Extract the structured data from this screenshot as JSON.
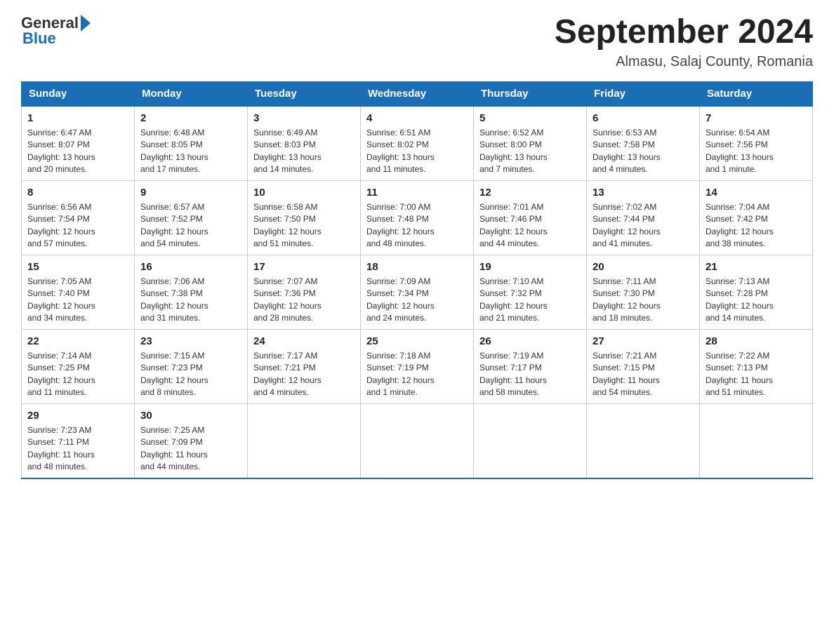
{
  "header": {
    "logo_general": "General",
    "logo_blue": "Blue",
    "month_title": "September 2024",
    "location": "Almasu, Salaj County, Romania"
  },
  "weekdays": [
    "Sunday",
    "Monday",
    "Tuesday",
    "Wednesday",
    "Thursday",
    "Friday",
    "Saturday"
  ],
  "weeks": [
    [
      {
        "day": "1",
        "info": "Sunrise: 6:47 AM\nSunset: 8:07 PM\nDaylight: 13 hours\nand 20 minutes."
      },
      {
        "day": "2",
        "info": "Sunrise: 6:48 AM\nSunset: 8:05 PM\nDaylight: 13 hours\nand 17 minutes."
      },
      {
        "day": "3",
        "info": "Sunrise: 6:49 AM\nSunset: 8:03 PM\nDaylight: 13 hours\nand 14 minutes."
      },
      {
        "day": "4",
        "info": "Sunrise: 6:51 AM\nSunset: 8:02 PM\nDaylight: 13 hours\nand 11 minutes."
      },
      {
        "day": "5",
        "info": "Sunrise: 6:52 AM\nSunset: 8:00 PM\nDaylight: 13 hours\nand 7 minutes."
      },
      {
        "day": "6",
        "info": "Sunrise: 6:53 AM\nSunset: 7:58 PM\nDaylight: 13 hours\nand 4 minutes."
      },
      {
        "day": "7",
        "info": "Sunrise: 6:54 AM\nSunset: 7:56 PM\nDaylight: 13 hours\nand 1 minute."
      }
    ],
    [
      {
        "day": "8",
        "info": "Sunrise: 6:56 AM\nSunset: 7:54 PM\nDaylight: 12 hours\nand 57 minutes."
      },
      {
        "day": "9",
        "info": "Sunrise: 6:57 AM\nSunset: 7:52 PM\nDaylight: 12 hours\nand 54 minutes."
      },
      {
        "day": "10",
        "info": "Sunrise: 6:58 AM\nSunset: 7:50 PM\nDaylight: 12 hours\nand 51 minutes."
      },
      {
        "day": "11",
        "info": "Sunrise: 7:00 AM\nSunset: 7:48 PM\nDaylight: 12 hours\nand 48 minutes."
      },
      {
        "day": "12",
        "info": "Sunrise: 7:01 AM\nSunset: 7:46 PM\nDaylight: 12 hours\nand 44 minutes."
      },
      {
        "day": "13",
        "info": "Sunrise: 7:02 AM\nSunset: 7:44 PM\nDaylight: 12 hours\nand 41 minutes."
      },
      {
        "day": "14",
        "info": "Sunrise: 7:04 AM\nSunset: 7:42 PM\nDaylight: 12 hours\nand 38 minutes."
      }
    ],
    [
      {
        "day": "15",
        "info": "Sunrise: 7:05 AM\nSunset: 7:40 PM\nDaylight: 12 hours\nand 34 minutes."
      },
      {
        "day": "16",
        "info": "Sunrise: 7:06 AM\nSunset: 7:38 PM\nDaylight: 12 hours\nand 31 minutes."
      },
      {
        "day": "17",
        "info": "Sunrise: 7:07 AM\nSunset: 7:36 PM\nDaylight: 12 hours\nand 28 minutes."
      },
      {
        "day": "18",
        "info": "Sunrise: 7:09 AM\nSunset: 7:34 PM\nDaylight: 12 hours\nand 24 minutes."
      },
      {
        "day": "19",
        "info": "Sunrise: 7:10 AM\nSunset: 7:32 PM\nDaylight: 12 hours\nand 21 minutes."
      },
      {
        "day": "20",
        "info": "Sunrise: 7:11 AM\nSunset: 7:30 PM\nDaylight: 12 hours\nand 18 minutes."
      },
      {
        "day": "21",
        "info": "Sunrise: 7:13 AM\nSunset: 7:28 PM\nDaylight: 12 hours\nand 14 minutes."
      }
    ],
    [
      {
        "day": "22",
        "info": "Sunrise: 7:14 AM\nSunset: 7:25 PM\nDaylight: 12 hours\nand 11 minutes."
      },
      {
        "day": "23",
        "info": "Sunrise: 7:15 AM\nSunset: 7:23 PM\nDaylight: 12 hours\nand 8 minutes."
      },
      {
        "day": "24",
        "info": "Sunrise: 7:17 AM\nSunset: 7:21 PM\nDaylight: 12 hours\nand 4 minutes."
      },
      {
        "day": "25",
        "info": "Sunrise: 7:18 AM\nSunset: 7:19 PM\nDaylight: 12 hours\nand 1 minute."
      },
      {
        "day": "26",
        "info": "Sunrise: 7:19 AM\nSunset: 7:17 PM\nDaylight: 11 hours\nand 58 minutes."
      },
      {
        "day": "27",
        "info": "Sunrise: 7:21 AM\nSunset: 7:15 PM\nDaylight: 11 hours\nand 54 minutes."
      },
      {
        "day": "28",
        "info": "Sunrise: 7:22 AM\nSunset: 7:13 PM\nDaylight: 11 hours\nand 51 minutes."
      }
    ],
    [
      {
        "day": "29",
        "info": "Sunrise: 7:23 AM\nSunset: 7:11 PM\nDaylight: 11 hours\nand 48 minutes."
      },
      {
        "day": "30",
        "info": "Sunrise: 7:25 AM\nSunset: 7:09 PM\nDaylight: 11 hours\nand 44 minutes."
      },
      {
        "day": "",
        "info": ""
      },
      {
        "day": "",
        "info": ""
      },
      {
        "day": "",
        "info": ""
      },
      {
        "day": "",
        "info": ""
      },
      {
        "day": "",
        "info": ""
      }
    ]
  ]
}
